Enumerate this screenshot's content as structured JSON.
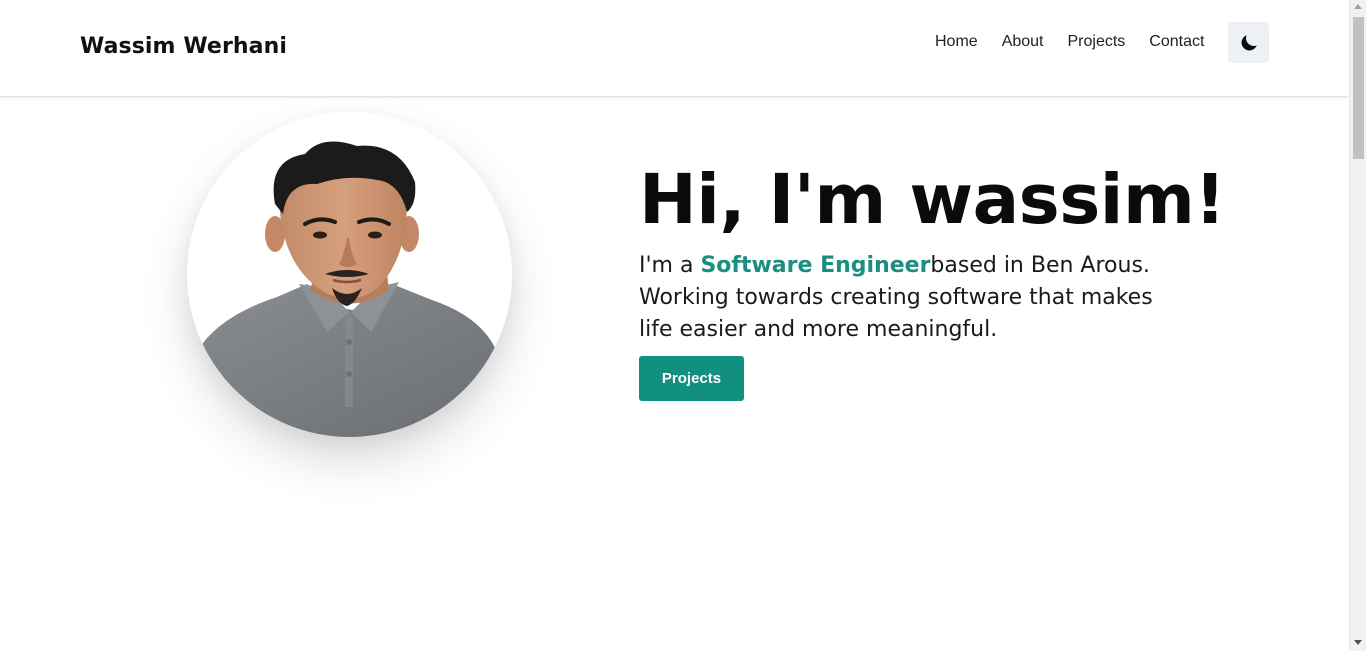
{
  "navbar": {
    "brand": "Wassim Werhani",
    "links": [
      {
        "label": "Home"
      },
      {
        "label": "About"
      },
      {
        "label": "Projects"
      },
      {
        "label": "Contact"
      }
    ],
    "theme_toggle_icon": "moon-icon"
  },
  "hero": {
    "title": "Hi, I'm wassim!",
    "intro_prefix": "I'm a ",
    "role": "Software Engineer",
    "intro_suffix": "based in Ben Arous. Working towards creating software that makes life easier and more meaningful.",
    "cta_label": "Projects",
    "avatar_icon": "profile-photo"
  },
  "colors": {
    "accent": "#11907f",
    "highlight_text": "#1a8e80",
    "toggle_bg": "#edf0f4"
  }
}
